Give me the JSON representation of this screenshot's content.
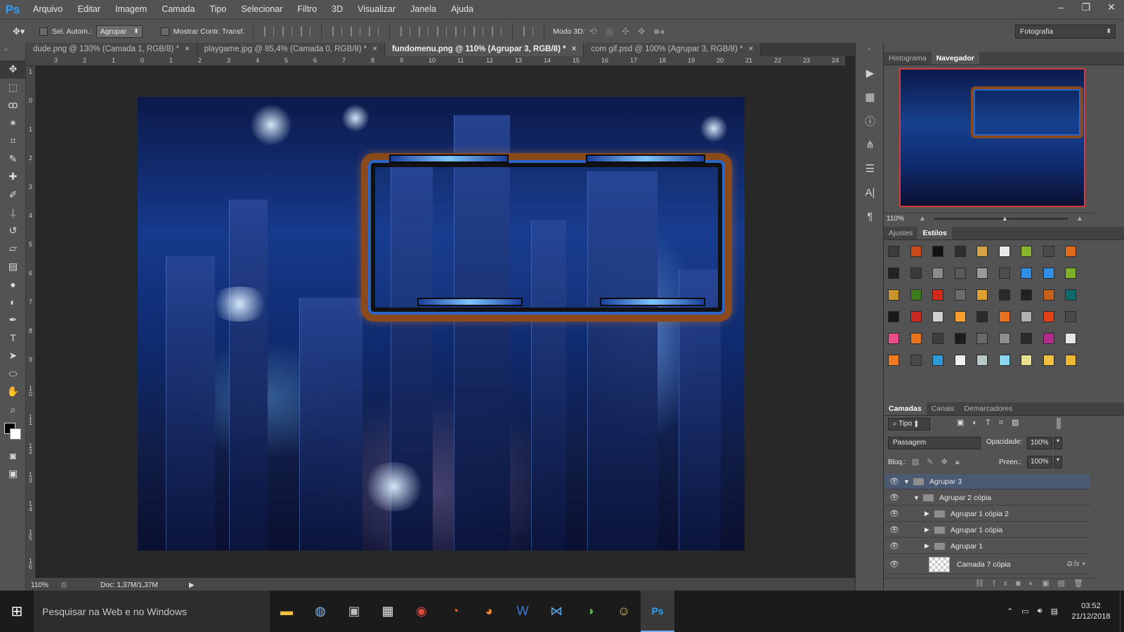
{
  "menubar": {
    "logo": "Ps",
    "items": [
      "Arquivo",
      "Editar",
      "Imagem",
      "Camada",
      "Tipo",
      "Selecionar",
      "Filtro",
      "3D",
      "Visualizar",
      "Janela",
      "Ajuda"
    ]
  },
  "options": {
    "auto_select_label": "Sel. Autom.:",
    "auto_select_value": "Agrupar",
    "show_transform_label": "Mostrar Contr. Transf.",
    "mode3d_label": "Modo 3D:",
    "workspace": "Fotografia"
  },
  "tabs": [
    {
      "label": "dude.png @ 130% (Camada 1, RGB/8) *"
    },
    {
      "label": "playgame.jpg @ 85,4% (Camada 0, RGB/8) *"
    },
    {
      "label": "fundomenu.png @ 110% (Agrupar 3, RGB/8) *"
    },
    {
      "label": "com gif.psd @ 100% (Agrupar 3, RGB/8) *"
    }
  ],
  "ruler_top": [
    "3",
    "2",
    "1",
    "0",
    "1",
    "2",
    "3",
    "4",
    "5",
    "6",
    "7",
    "8",
    "9",
    "10",
    "11",
    "12",
    "13",
    "14",
    "15",
    "16",
    "17",
    "18",
    "19",
    "20",
    "21",
    "22",
    "23",
    "24"
  ],
  "ruler_left": [
    "1",
    "0",
    "1",
    "2",
    "3",
    "4",
    "5",
    "6",
    "7",
    "8",
    "9",
    "1\n0",
    "1\n1",
    "1\n2",
    "1\n3",
    "1\n4",
    "1\n5",
    "1\n6"
  ],
  "status": {
    "zoom": "110%",
    "doc": "Doc: 1,37M/1,37M"
  },
  "navigator_panel": {
    "tabs": [
      "Histograma",
      "Navegador"
    ],
    "zoom": "110%"
  },
  "styles_panel": {
    "tabs": [
      "Ajustes",
      "Estilos"
    ],
    "swatch_colors": [
      "#3b3b3b",
      "#c94a16",
      "#111111",
      "#2e2e2e",
      "#d5a247",
      "#e8e8e8",
      "#8ab42c",
      "#4a4a4a",
      "#e06a1a",
      "#232323",
      "#3a3a3a",
      "#8c8c8c",
      "#5a5a5a",
      "#9a9a9a",
      "#4d4d4d",
      "#2f8fe6",
      "#2f8fe6",
      "#7fb02a",
      "#c9952a",
      "#3c7a1c",
      "#d22a1a",
      "#6c6c6c",
      "#e0a030",
      "#2a2a2a",
      "#222222",
      "#c96018",
      "#0f6b6b",
      "#1a1a1a",
      "#c82a22",
      "#cfcfcf",
      "#f5a030",
      "#2a2a2a",
      "#e87020",
      "#b0b0b0",
      "#e04018",
      "#4a4a4a",
      "#e84d8a",
      "#e8741c",
      "#3e3e3e",
      "#1c1c1c",
      "#6a6a6a",
      "#8e8e8e",
      "#2a2a2a",
      "#b42a8e",
      "#e6e6e6",
      "#f07a20",
      "#4a4a4a",
      "#2f9ad8",
      "#efefef",
      "#b8c8c8",
      "#8ad8f0",
      "#e6e090",
      "#f0c040",
      "#f0b830"
    ]
  },
  "layers_panel": {
    "tabs": [
      "Camadas",
      "Canais",
      "Demarcadores"
    ],
    "filter": "Tipo",
    "blend_mode": "Passagem",
    "opacity_label": "Opacidade:",
    "opacity": "100%",
    "lock_label": "Bloq.:",
    "fill_label": "Preen.:",
    "fill": "100%",
    "layers": [
      {
        "name": "Agrupar 3"
      },
      {
        "name": "Agrupar 2 cópia"
      },
      {
        "name": "Agrupar 1 cópia 2"
      },
      {
        "name": "Agrupar 1 cópia"
      },
      {
        "name": "Agrupar 1"
      },
      {
        "name": "Camada 7 cópia"
      }
    ]
  },
  "taskbar": {
    "search_placeholder": "Pesquisar na Web e no Windows",
    "time": "03:52",
    "date": "21/12/2018"
  }
}
